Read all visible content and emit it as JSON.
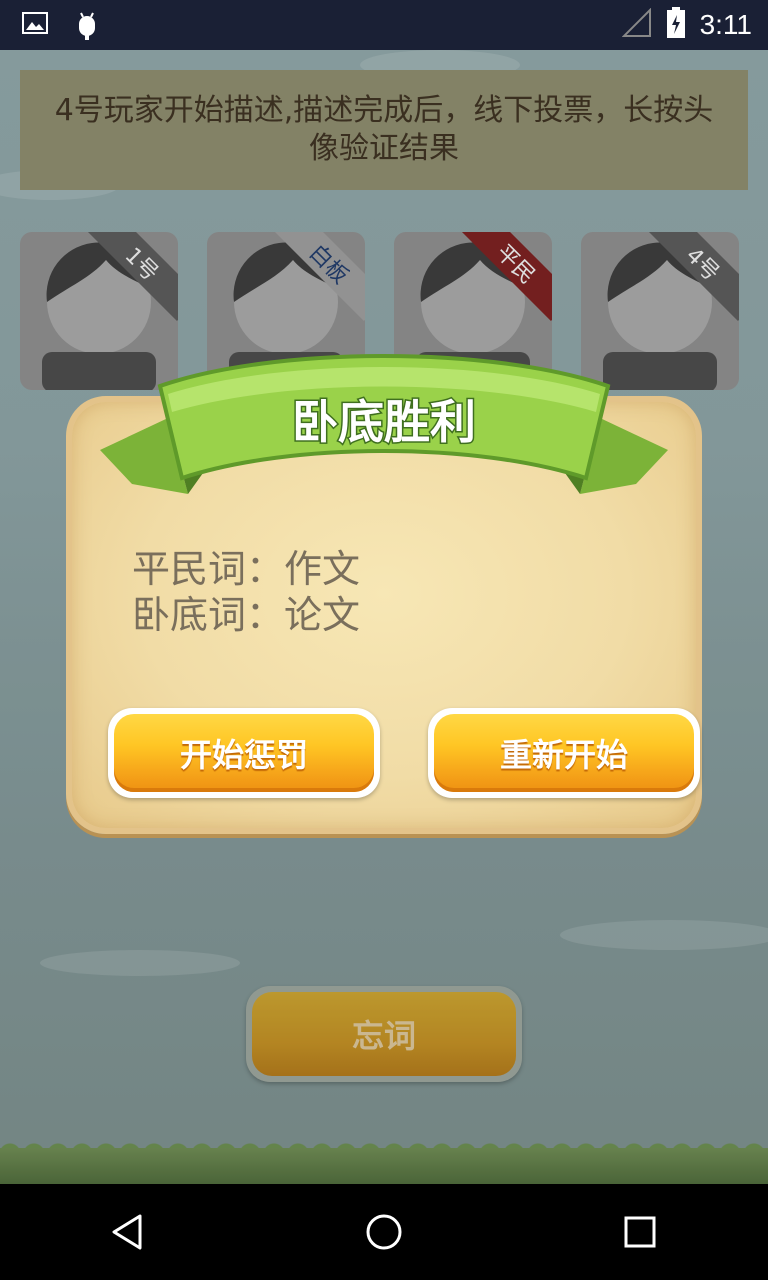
{
  "status_bar": {
    "time": "3:11",
    "left_icons": [
      "image-icon",
      "android-debug-icon"
    ],
    "right_icons": [
      "signal-icon",
      "battery-icon"
    ]
  },
  "game": {
    "instruction": "4号玩家开始描述,描述完成后，线下投票，长按头像验证结果",
    "players": [
      {
        "tag": "1号",
        "ribbon_color": "#5a5a5a"
      },
      {
        "tag": "白板",
        "ribbon_color": "#9c9c9c"
      },
      {
        "tag": "平民",
        "ribbon_color": "#7a1f1f"
      },
      {
        "tag": "4号",
        "ribbon_color": "#5a5a5a"
      }
    ],
    "forget_button": "忘词"
  },
  "result_dialog": {
    "title": "卧底胜利",
    "civilian_word_label": "平民词：",
    "civilian_word": "作文",
    "undercover_word_label": "卧底词：",
    "undercover_word": "论文",
    "punish_button": "开始惩罚",
    "restart_button": "重新开始"
  },
  "nav_bar": {
    "buttons": [
      "back-icon",
      "home-icon",
      "recents-icon"
    ]
  },
  "colors": {
    "accent_orange": "#f6a51a",
    "ribbon_green": "#8cc63f",
    "parchment": "#f1dca6"
  }
}
